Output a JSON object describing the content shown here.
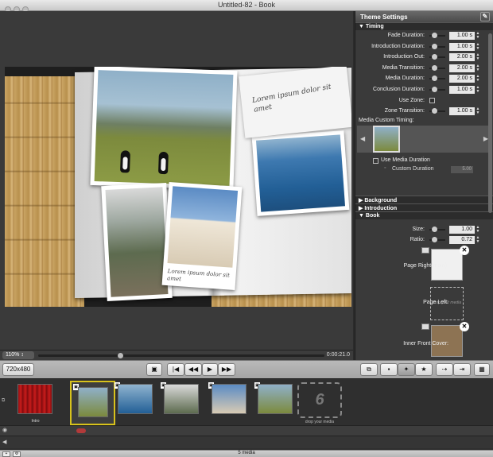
{
  "window": {
    "title": "Untitled-82 - Book"
  },
  "preview": {
    "note_caption": "Lorem ipsum dolor sit amet",
    "photo_caption": "Lorem ipsum dolor sit amet",
    "zoom": "110%",
    "timecode": "0:00:21.0"
  },
  "panel": {
    "title": "Theme Settings",
    "timing": {
      "header": "Timing",
      "rows": [
        {
          "label": "Fade Duration:",
          "value": "1.00 s"
        },
        {
          "label": "Introduction Duration:",
          "value": "1.00 s"
        },
        {
          "label": "Introduction Out:",
          "value": "2.00 s"
        },
        {
          "label": "Media Transition:",
          "value": "2.00 s"
        },
        {
          "label": "Media Duration:",
          "value": "2.00 s"
        },
        {
          "label": "Conclusion Duration:",
          "value": "1.00 s"
        }
      ],
      "use_zone": "Use Zone:",
      "zone_transition": {
        "label": "Zone Transition:",
        "value": "1.00 s"
      },
      "media_custom_timing": "Media Custom Timing:",
      "use_media_duration": "Use Media Duration",
      "custom_duration": {
        "label": "Custom Duration",
        "value": "5.00"
      }
    },
    "sections": {
      "background": "Background",
      "introduction": "Introduction",
      "book": "Book"
    },
    "book": {
      "size": {
        "label": "Size:",
        "value": "1.00"
      },
      "ratio": {
        "label": "Ratio:",
        "value": "0.72"
      },
      "page_right": "Page Right(main):",
      "page_left": "Page Left:",
      "drop_media": "drop your media",
      "inner_front_cover": "Inner Front Cover:"
    }
  },
  "toolbar": {
    "resolution": "720x480"
  },
  "strip": {
    "intro_label": "Intro",
    "drop_number": "6",
    "drop_label": "drop your media",
    "status": "5 media"
  }
}
